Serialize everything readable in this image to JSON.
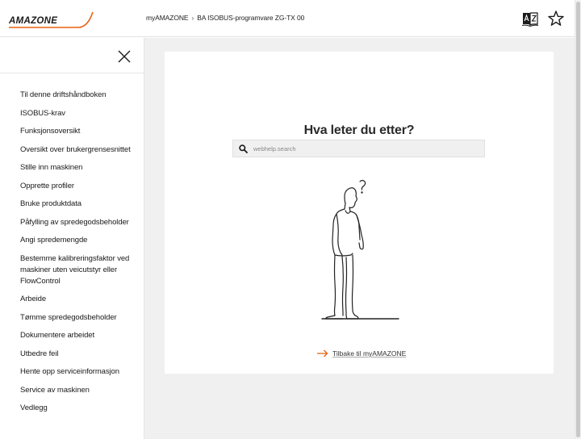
{
  "header": {
    "brand": "AMAZONE",
    "breadcrumb": [
      "myAMAZONE",
      "BA ISOBUS-programvare ZG-TX 00"
    ],
    "breadcrumb_separator": "›",
    "icons": [
      "language-az-icon",
      "star-icon"
    ],
    "accent_color": "#e8600f"
  },
  "sidebar": {
    "close_icon": "close-icon",
    "items": [
      "Til denne driftshåndboken",
      "ISOBUS-krav",
      "Funksjonsoversikt",
      "Oversikt over brukergrensesnittet",
      "Stille inn maskinen",
      "Opprette profiler",
      "Bruke produktdata",
      "Påfylling av spredegodsbeholder",
      "Angi spredemengde",
      "Bestemme kalibreringsfaktor ved maskiner uten veicutstyr eller FlowControl",
      "Arbeide",
      "Tømme spredegodsbeholder",
      "Dokumentere arbeidet",
      "Utbedre feil",
      "Hente opp serviceinformasjon",
      "Service av maskinen",
      "Vedlegg"
    ]
  },
  "main": {
    "title": "Hva leter du etter?",
    "search": {
      "placeholder": "webhelp.search",
      "value": ""
    },
    "illustration": "person-looking-up-question-mark",
    "back_link": "Tilbake til myAMAZONE"
  }
}
